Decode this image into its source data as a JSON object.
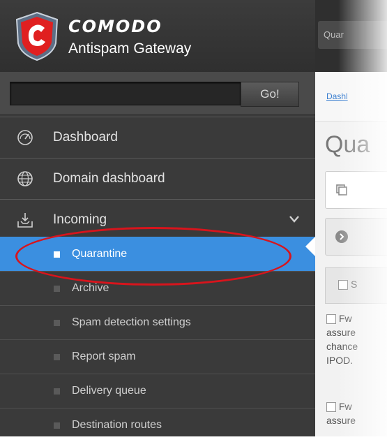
{
  "brand": {
    "name": "COMODO",
    "subtitle": "Antispam Gateway"
  },
  "search": {
    "placeholder": "",
    "go_label": "Go!"
  },
  "nav": {
    "dashboard": "Dashboard",
    "domain_dashboard": "Domain dashboard",
    "incoming": "Incoming"
  },
  "incoming_items": [
    {
      "label": "Quarantine",
      "active": true
    },
    {
      "label": "Archive"
    },
    {
      "label": "Spam detection settings"
    },
    {
      "label": "Report spam"
    },
    {
      "label": "Delivery queue"
    },
    {
      "label": "Destination routes"
    }
  ],
  "right": {
    "tab_label": "Quar",
    "breadcrumb": "Dashl",
    "page_title": "Qua",
    "filter_label": "S",
    "row1": [
      "Fw",
      "assure",
      "chance",
      "IPOD."
    ],
    "row2": [
      "Fw",
      "assure"
    ]
  },
  "colors": {
    "active": "#3b8fe0",
    "annotation": "#d8141c",
    "sidebar_bg": "#3a3a3a"
  }
}
